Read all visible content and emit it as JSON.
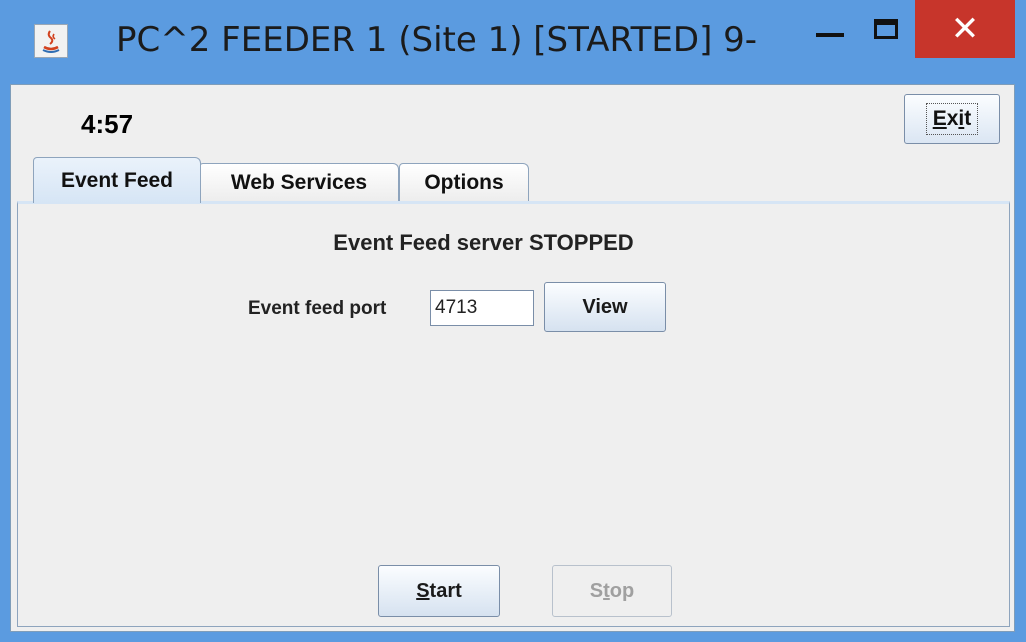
{
  "window": {
    "title": "PC^2 FEEDER 1 (Site 1) [STARTED] 9-",
    "minimize_icon": "minimize-icon",
    "maximize_icon": "maximize-icon",
    "close_icon": "close-icon",
    "close_glyph": "✕"
  },
  "header": {
    "clock": "4:57",
    "exit_label": "Exit"
  },
  "tabs": [
    {
      "label": "Event Feed",
      "active": true
    },
    {
      "label": "Web Services",
      "active": false
    },
    {
      "label": "Options",
      "active": false
    }
  ],
  "event_feed": {
    "status": "Event Feed server STOPPED",
    "port_label": "Event feed port",
    "port_value": "4713",
    "view_label": "View",
    "start_label": "Start",
    "stop_label": "Stop",
    "stop_enabled": false
  },
  "colors": {
    "title_bar": "#5b9be0",
    "close_button": "#c7352b",
    "panel": "#efefef"
  }
}
